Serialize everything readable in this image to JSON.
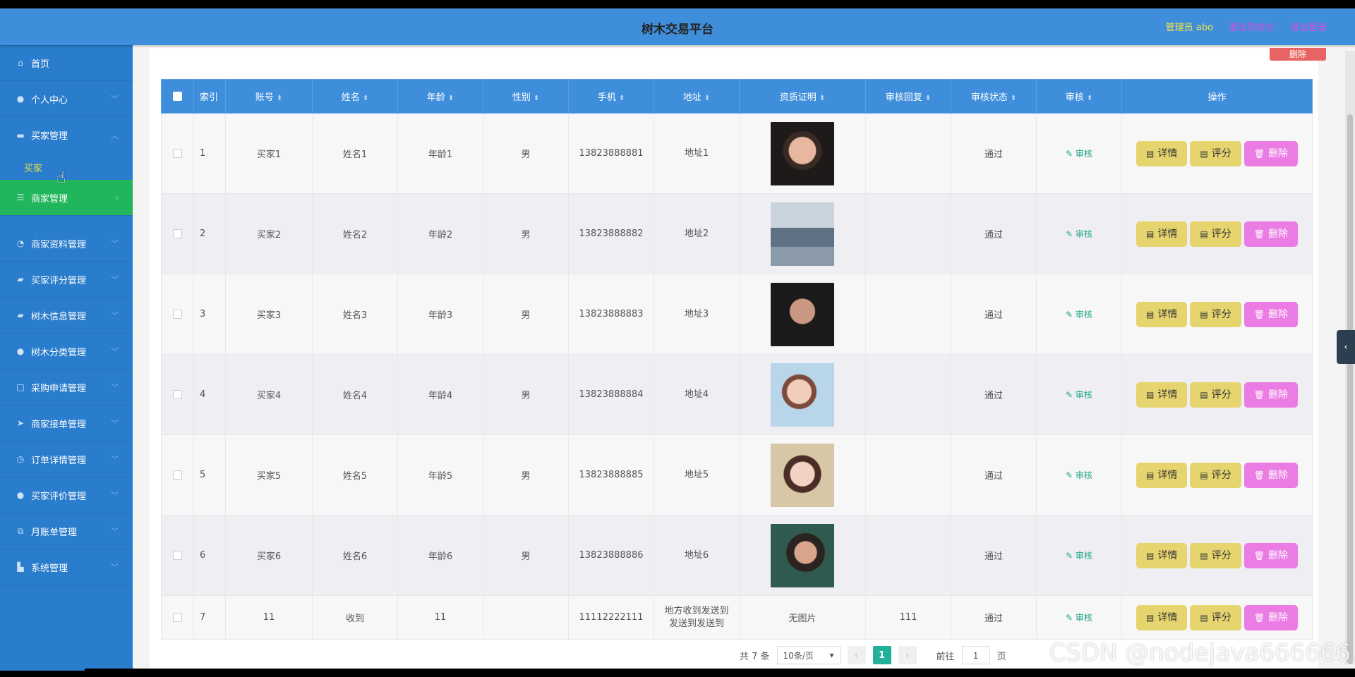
{
  "header": {
    "title": "树木交易平台",
    "admin": "管理员 abo",
    "link_front": "退出到前台",
    "link_logout": "退出登录"
  },
  "sidebar": {
    "items": [
      {
        "label": "首页",
        "icon": "home-icon"
      },
      {
        "label": "个人中心",
        "icon": "user-icon"
      },
      {
        "label": "买家管理",
        "icon": "users-icon"
      },
      {
        "label": "商家管理",
        "icon": "list-icon"
      },
      {
        "label": "商家资料管理",
        "icon": "bell-icon"
      },
      {
        "label": "买家评分管理",
        "icon": "chat-icon"
      },
      {
        "label": "树木信息管理",
        "icon": "chat-icon"
      },
      {
        "label": "树木分类管理",
        "icon": "user-icon"
      },
      {
        "label": "采购申请管理",
        "icon": "square-icon"
      },
      {
        "label": "商家接单管理",
        "icon": "send-icon"
      },
      {
        "label": "订单详情管理",
        "icon": "clock-icon"
      },
      {
        "label": "买家评价管理",
        "icon": "user-icon"
      },
      {
        "label": "月账单管理",
        "icon": "copy-icon"
      },
      {
        "label": "系统管理",
        "icon": "bank-icon"
      }
    ],
    "sub_item": "买家"
  },
  "table": {
    "top_delete": "删除",
    "headers": [
      "索引",
      "账号",
      "姓名",
      "年龄",
      "性别",
      "手机",
      "地址",
      "资质证明",
      "审核回复",
      "审核状态",
      "审核",
      "操作"
    ],
    "rows": [
      {
        "index": "1",
        "account": "买家1",
        "name": "姓名1",
        "age": "年龄1",
        "gender": "男",
        "phone": "13823888881",
        "address": "地址1",
        "reply": "",
        "status": "通过"
      },
      {
        "index": "2",
        "account": "买家2",
        "name": "姓名2",
        "age": "年龄2",
        "gender": "男",
        "phone": "13823888882",
        "address": "地址2",
        "reply": "",
        "status": "通过"
      },
      {
        "index": "3",
        "account": "买家3",
        "name": "姓名3",
        "age": "年龄3",
        "gender": "男",
        "phone": "13823888883",
        "address": "地址3",
        "reply": "",
        "status": "通过"
      },
      {
        "index": "4",
        "account": "买家4",
        "name": "姓名4",
        "age": "年龄4",
        "gender": "男",
        "phone": "13823888884",
        "address": "地址4",
        "reply": "",
        "status": "通过"
      },
      {
        "index": "5",
        "account": "买家5",
        "name": "姓名5",
        "age": "年龄5",
        "gender": "男",
        "phone": "13823888885",
        "address": "地址5",
        "reply": "",
        "status": "通过"
      },
      {
        "index": "6",
        "account": "买家6",
        "name": "姓名6",
        "age": "年龄6",
        "gender": "男",
        "phone": "13823888886",
        "address": "地址6",
        "reply": "",
        "status": "通过"
      },
      {
        "index": "7",
        "account": "11",
        "name": "收到",
        "age": "11",
        "gender": "",
        "phone": "11112222111",
        "address": "地方收到发送到发送到发送到",
        "photo_text": "无图片",
        "reply": "111",
        "status": "通过"
      }
    ],
    "audit_label": "审核",
    "btn_detail": "详情",
    "btn_rate": "评分",
    "btn_delete": "删除"
  },
  "pager": {
    "total": "共 7 条",
    "page_size": "10条/页",
    "current": "1",
    "goto_label": "前往",
    "goto_value": "1",
    "page_suffix": "页"
  },
  "watermark": "CSDN @nodejava666666",
  "colors": {
    "header_bg": "#3f8edb",
    "sidebar_bg": "#2a7ccc",
    "active_nav": "#21b65b",
    "btn_yellow": "#e6d46e",
    "btn_pink": "#ea7ce4",
    "pager_active": "#21b09a"
  }
}
